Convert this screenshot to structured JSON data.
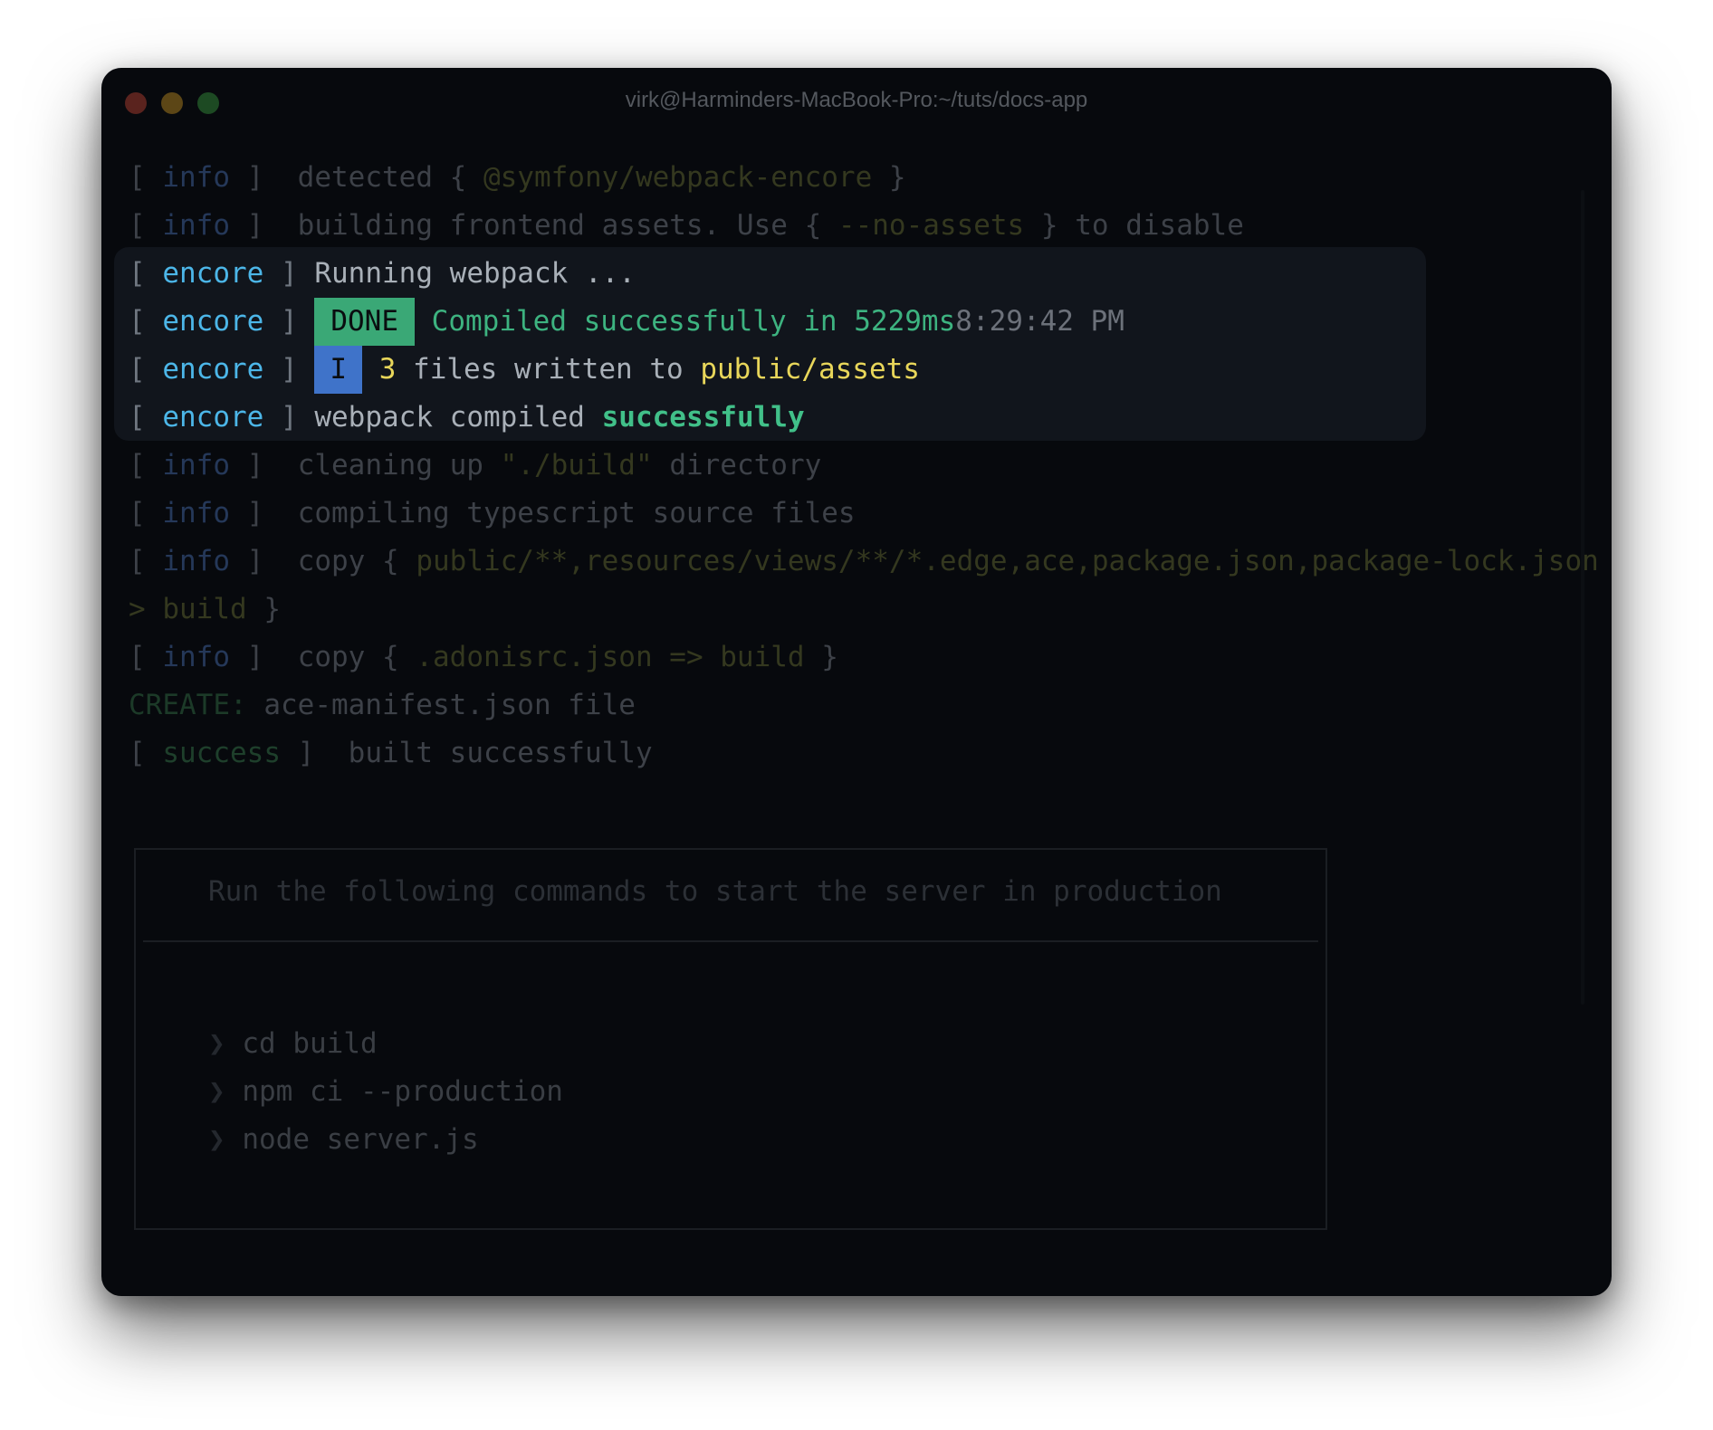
{
  "window": {
    "title": "virk@Harminders-MacBook-Pro:~/tuts/docs-app"
  },
  "lines": [
    {
      "open": "[",
      "tag": "info",
      "close": "]",
      "text": "detected {",
      "arg": "@symfony/webpack-encore",
      "end": "}"
    },
    {
      "open": "[",
      "tag": "info",
      "close": "]",
      "text": "building frontend assets. Use {",
      "arg": "--no-assets",
      "end": "} to disable"
    },
    {
      "open": "[",
      "tag": "encore",
      "close": "]",
      "text": "Running webpack ..."
    },
    {
      "open": "[",
      "tag": "encore",
      "close": "]",
      "badge": "DONE",
      "text": "Compiled successfully in 5229ms",
      "time": "8:29:42 PM"
    },
    {
      "open": "[",
      "tag": "encore",
      "close": "]",
      "badge": "I",
      "count": "3",
      "text": "files written to",
      "path": "public/assets"
    },
    {
      "open": "[",
      "tag": "encore",
      "close": "]",
      "text": "webpack compiled",
      "status": "successfully"
    },
    {
      "open": "[",
      "tag": "info",
      "close": "]",
      "text": "cleaning up",
      "arg": "\"./build\"",
      "end": "directory"
    },
    {
      "open": "[",
      "tag": "info",
      "close": "]",
      "text": "compiling typescript source files"
    },
    {
      "open": "[",
      "tag": "info",
      "close": "]",
      "text": "copy {",
      "arg": "public/**,resources/views/**/*.edge,ace,package.json,package-lock.json =",
      "arg2": "> build",
      "end": "}"
    },
    {
      "open": "[",
      "tag": "info",
      "close": "]",
      "text": "copy {",
      "arg": ".adonisrc.json => build",
      "end": "}"
    },
    {
      "label": "CREATE:",
      "text": "ace-manifest.json file"
    },
    {
      "open": "[",
      "tag": "success",
      "close": "]",
      "text": "built successfully"
    }
  ],
  "box": {
    "heading": "Run the following commands to start the server in production",
    "prompt": "❯",
    "commands": [
      "cd build",
      "npm ci --production",
      "node server.js"
    ]
  }
}
